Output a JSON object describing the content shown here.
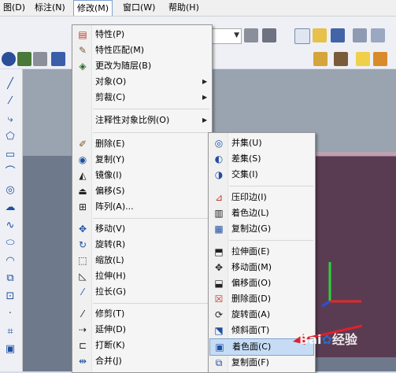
{
  "menubar": {
    "items": [
      "图(D)",
      "标注(N)",
      "修改(M)",
      "窗口(W)",
      "帮助(H)"
    ]
  },
  "modify_menu": {
    "items": [
      {
        "label": "特性(P)",
        "icon": "properties-icon"
      },
      {
        "label": "特性匹配(M)",
        "icon": "match-brush-icon"
      },
      {
        "label": "更改为随层(B)",
        "icon": "change-bylayer-icon"
      },
      {
        "label": "对象(O)",
        "submenu": true
      },
      {
        "label": "剪裁(C)",
        "submenu": true
      },
      {
        "label": "注释性对象比例(O)",
        "submenu": true
      },
      {
        "label": "删除(E)",
        "icon": "eraser-icon"
      },
      {
        "label": "复制(Y)",
        "icon": "copy-icon"
      },
      {
        "label": "镜像(I)",
        "icon": "mirror-icon"
      },
      {
        "label": "偏移(S)",
        "icon": "offset-icon"
      },
      {
        "label": "阵列(A)...",
        "icon": "array-icon"
      },
      {
        "label": "移动(V)",
        "icon": "move-icon"
      },
      {
        "label": "旋转(R)",
        "icon": "rotate-icon"
      },
      {
        "label": "缩放(L)",
        "icon": "scale-icon"
      },
      {
        "label": "拉伸(H)",
        "icon": "stretch-icon"
      },
      {
        "label": "拉长(G)",
        "icon": "lengthen-icon"
      },
      {
        "label": "修剪(T)",
        "icon": "trim-icon"
      },
      {
        "label": "延伸(D)",
        "icon": "extend-icon"
      },
      {
        "label": "打断(K)",
        "icon": "break-icon"
      },
      {
        "label": "合并(J)",
        "icon": "join-icon"
      }
    ]
  },
  "solid_submenu": {
    "items": [
      {
        "label": "并集(U)",
        "icon": "union-icon"
      },
      {
        "label": "差集(S)",
        "icon": "subtract-icon"
      },
      {
        "label": "交集(I)",
        "icon": "intersect-icon"
      },
      {
        "label": "压印边(I)",
        "icon": "imprint-icon"
      },
      {
        "label": "着色边(L)",
        "icon": "color-edges-icon"
      },
      {
        "label": "复制边(G)",
        "icon": "copy-edges-icon"
      },
      {
        "label": "拉伸面(E)",
        "icon": "extrude-faces-icon"
      },
      {
        "label": "移动面(M)",
        "icon": "move-faces-icon"
      },
      {
        "label": "偏移面(O)",
        "icon": "offset-faces-icon"
      },
      {
        "label": "删除面(D)",
        "icon": "delete-faces-icon"
      },
      {
        "label": "旋转面(A)",
        "icon": "rotate-faces-icon"
      },
      {
        "label": "倾斜面(T)",
        "icon": "taper-faces-icon"
      },
      {
        "label": "着色面(C)",
        "icon": "color-faces-icon",
        "highlighted": true
      },
      {
        "label": "复制面(F)",
        "icon": "copy-faces-icon"
      }
    ]
  },
  "watermark": {
    "text": "Bai",
    "text2": "经验"
  },
  "colors": {
    "highlight": "#c6dcf5",
    "arrow": "#e0202a"
  }
}
